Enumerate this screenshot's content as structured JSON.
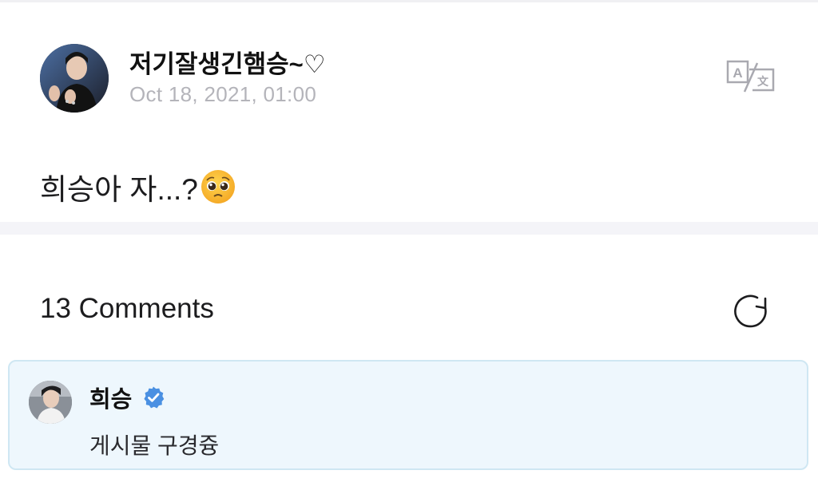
{
  "post": {
    "author": "저기잘생긴햄승~♡",
    "date": "Oct 18, 2021, 01:00",
    "body_text": "희승아 자...?",
    "body_emoji": "pleading-face-emoji",
    "translate_icon": "translate-icon"
  },
  "comments": {
    "header": "13 Comments",
    "refresh_icon": "refresh-icon",
    "items": [
      {
        "author": "희승",
        "verified": true,
        "text": "게시물 구경즁",
        "highlight_color": "#eef7fd"
      }
    ]
  },
  "colors": {
    "verified_badge": "#4a90e2",
    "date_text": "#b4b4ba",
    "comment_card_border": "#cfe7f3"
  }
}
